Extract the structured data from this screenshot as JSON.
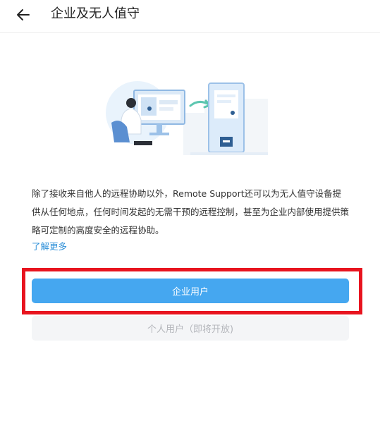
{
  "header": {
    "back_icon": "arrow-left-icon",
    "title": "企业及无人值守"
  },
  "illustration": {
    "icon": "remote-support-illustration"
  },
  "main": {
    "description": "除了接收来自他人的远程协助以外，Remote Support还可以为无人值守设备提供从任何地点，任何时间发起的无需干预的远程控制，甚至为企业内部使用提供策略可定制的高度安全的远程协助。",
    "learn_more": "了解更多"
  },
  "buttons": {
    "enterprise_user": "企业用户",
    "personal_user": "个人用户（即将开放)"
  },
  "colors": {
    "accent": "#45a7f0",
    "link": "#2d8fd8",
    "highlight": "#e8141f",
    "disabled_bg": "#f4f5f7",
    "disabled_text": "#b4b6bb"
  }
}
